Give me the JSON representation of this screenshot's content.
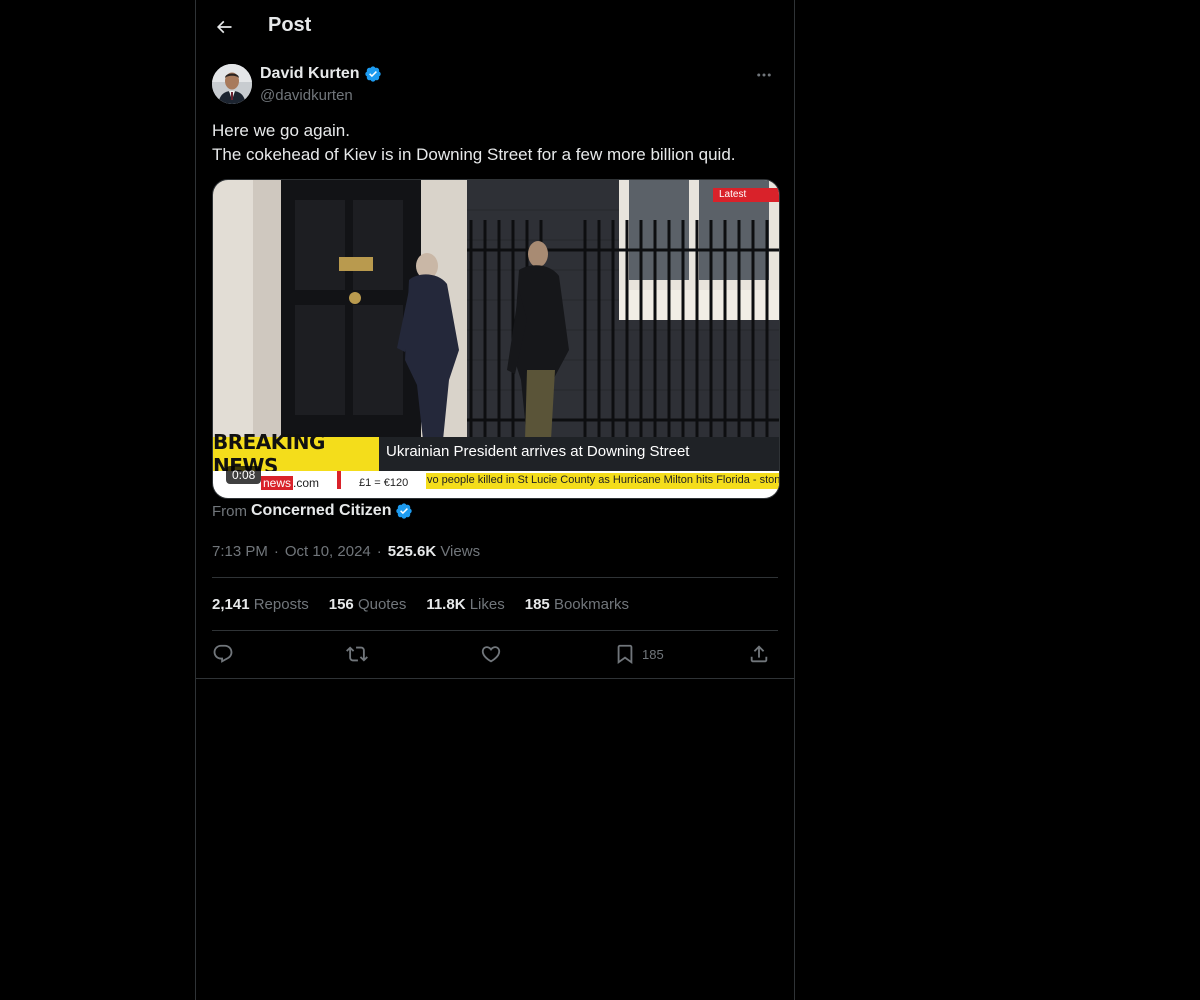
{
  "header": {
    "title": "Post"
  },
  "author": {
    "name": "David Kurten",
    "handle": "@davidkurten",
    "verified": true
  },
  "post": {
    "lines": [
      "Here we go again.",
      "The cokehead of Kiev is in Downing Street for a few more billion quid."
    ]
  },
  "media": {
    "latest_tag": "Latest",
    "breaking_label": "BREAKING NEWS",
    "headline": "Ukrainian President arrives at Downing Street",
    "ticker_logo_prefix": "",
    "ticker_logo_red": "news",
    "ticker_logo_suffix": ".com",
    "ticker_rate": "£1 = €120",
    "ticker_text": "vo people killed in St Lucie County as Hurricane Milton hits Florida - ston",
    "duration": "0:08"
  },
  "source": {
    "prefix": "From",
    "name": "Concerned Citizen",
    "verified": true
  },
  "meta": {
    "time": "7:13 PM",
    "date": "Oct 10, 2024",
    "views_count": "525.6K",
    "views_label": "Views"
  },
  "stats": [
    {
      "count": "2,141",
      "label": "Reposts"
    },
    {
      "count": "156",
      "label": "Quotes"
    },
    {
      "count": "11.8K",
      "label": "Likes"
    },
    {
      "count": "185",
      "label": "Bookmarks"
    }
  ],
  "actions": {
    "bookmark_count": "185"
  },
  "colors": {
    "background": "#000000",
    "text": "#e7e9ea",
    "muted": "#71767b",
    "border": "#2f3336",
    "verified": "#1d9bf0",
    "breaking": "#f4dd1b"
  },
  "icons": [
    "back-arrow-icon",
    "verified-badge-icon",
    "more-icon",
    "reply-icon",
    "repost-icon",
    "like-icon",
    "bookmark-icon",
    "share-icon"
  ]
}
